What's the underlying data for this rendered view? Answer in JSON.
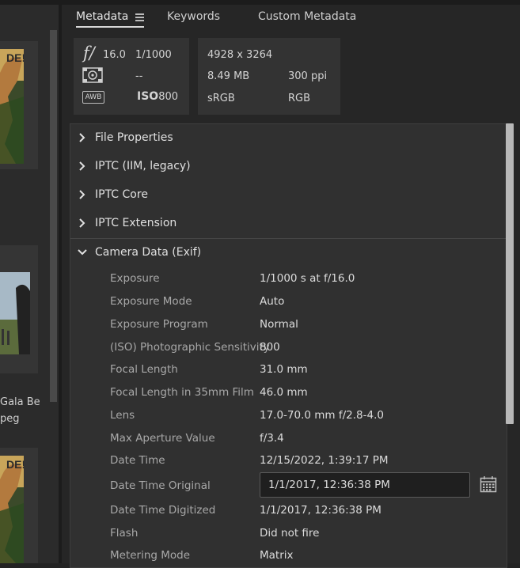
{
  "left_panel": {
    "thumbnail_captions": [
      "Gala Be",
      "peg"
    ]
  },
  "tabs": [
    {
      "label": "Metadata"
    },
    {
      "label": "Keywords"
    },
    {
      "label": "Custom Metadata"
    }
  ],
  "quick_info": {
    "aperture": "16.0",
    "shutter": "1/1000",
    "metering": "--",
    "iso_label": "ISO",
    "iso_value": "800",
    "dimensions": "4928 x 3264",
    "file_size": "8.49 MB",
    "resolution": "300 ppi",
    "color_profile": "sRGB",
    "color_mode": "RGB",
    "awb_label": "AWB",
    "aperture_symbol": "f/"
  },
  "sections": [
    {
      "label": "File Properties",
      "expanded": false
    },
    {
      "label": "IPTC (IIM, legacy)",
      "expanded": false
    },
    {
      "label": "IPTC Core",
      "expanded": false
    },
    {
      "label": "IPTC Extension",
      "expanded": false
    },
    {
      "label": "Camera Data (Exif)",
      "expanded": true
    }
  ],
  "exif_fields": [
    {
      "label": "Exposure",
      "value": "1/1000 s at f/16.0"
    },
    {
      "label": "Exposure Mode",
      "value": "Auto"
    },
    {
      "label": "Exposure Program",
      "value": "Normal"
    },
    {
      "label": "(ISO) Photographic Sensitivity",
      "value": "800"
    },
    {
      "label": "Focal Length",
      "value": "31.0 mm"
    },
    {
      "label": "Focal Length in 35mm Film",
      "value": "46.0 mm"
    },
    {
      "label": "Lens",
      "value": "17.0-70.0 mm f/2.8-4.0"
    },
    {
      "label": "Max Aperture Value",
      "value": "f/3.4"
    },
    {
      "label": "Date Time",
      "value": "12/15/2022, 1:39:17 PM"
    },
    {
      "label": "Date Time Original",
      "value": "1/1/2017, 12:36:38 PM"
    },
    {
      "label": "Date Time Digitized",
      "value": "1/1/2017, 12:36:38 PM"
    },
    {
      "label": "Flash",
      "value": "Did not fire"
    },
    {
      "label": "Metering Mode",
      "value": "Matrix"
    }
  ]
}
